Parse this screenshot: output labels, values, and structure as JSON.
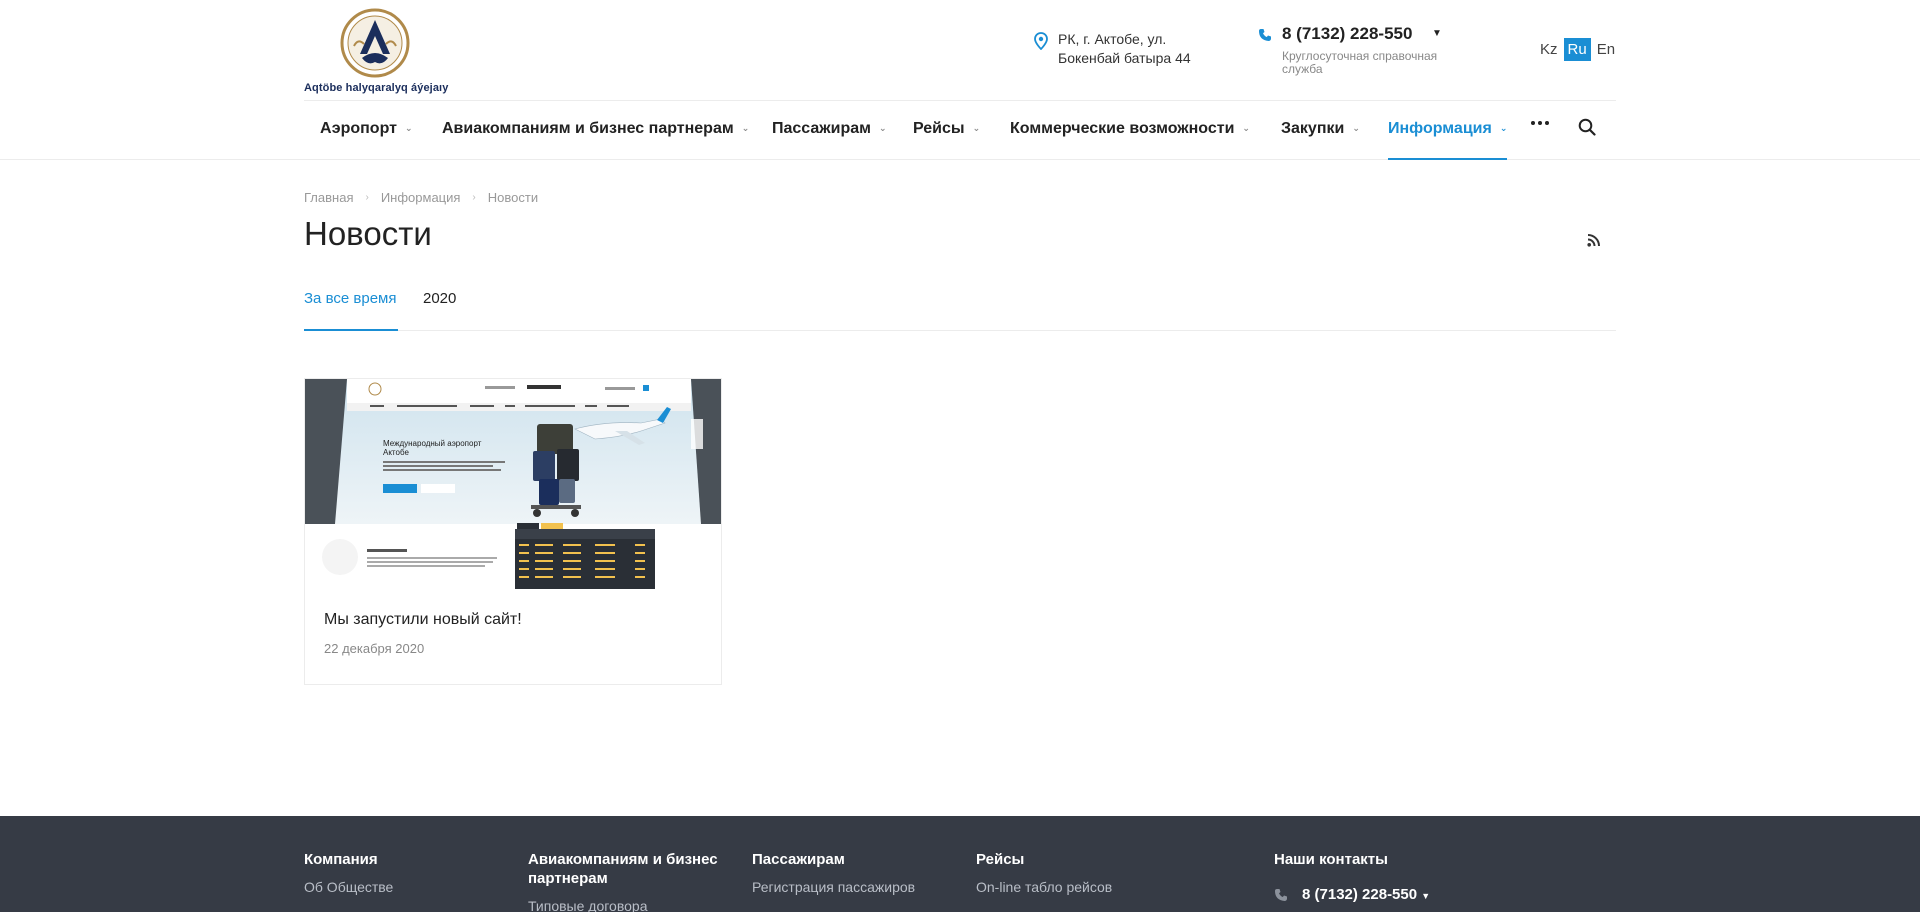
{
  "header": {
    "logo_caption": "Aqtöbe halyqaralyq áýejaıy",
    "address_line1": "РК, г. Актобе, ул.",
    "address_line2": "Бокенбай батыра 44",
    "phone": "8 (7132) 228-550",
    "phone_caption": "Круглосуточная справочная служба",
    "languages": [
      {
        "label": "Kz",
        "active": false
      },
      {
        "label": "Ru",
        "active": true
      },
      {
        "label": "En",
        "active": false
      }
    ]
  },
  "nav": {
    "items": [
      {
        "label": "Аэропорт"
      },
      {
        "label": "Авиакомпаниям и бизнес партнерам"
      },
      {
        "label": "Пассажирам"
      },
      {
        "label": "Рейсы"
      },
      {
        "label": "Коммерческие возможности"
      },
      {
        "label": "Закупки"
      },
      {
        "label": "Информация",
        "active": true
      }
    ],
    "more_icon": "ellipsis-icon",
    "search_icon": "search-icon"
  },
  "breadcrumb": [
    "Главная",
    "Информация",
    "Новости"
  ],
  "page": {
    "title": "Новости",
    "rss_icon": "rss-icon"
  },
  "tabs": [
    {
      "label": "За все время",
      "active": true
    },
    {
      "label": "2020",
      "active": false
    }
  ],
  "news": [
    {
      "title": "Мы запустили новый сайт!",
      "date": "22 декабря 2020",
      "thumb_heading_1": "Международный аэропорт",
      "thumb_heading_2": "Актобе"
    }
  ],
  "footer": {
    "columns": [
      {
        "heading": "Компания",
        "links": [
          "Об Обществе"
        ]
      },
      {
        "heading": "Авиакомпаниям и бизнес партнерам",
        "links": [
          "Типовые договора"
        ]
      },
      {
        "heading": "Пассажирам",
        "links": [
          "Регистрация пассажиров"
        ]
      },
      {
        "heading": "Рейсы",
        "links": [
          "On-line табло рейсов"
        ]
      },
      {
        "heading": "Наши контакты",
        "links": []
      }
    ],
    "phone": "8 (7132) 228-550"
  },
  "colors": {
    "accent": "#1a8ed4",
    "footer_bg": "#363b45",
    "logo_dark": "#1b2e5c",
    "logo_gold": "#b08a4a"
  }
}
